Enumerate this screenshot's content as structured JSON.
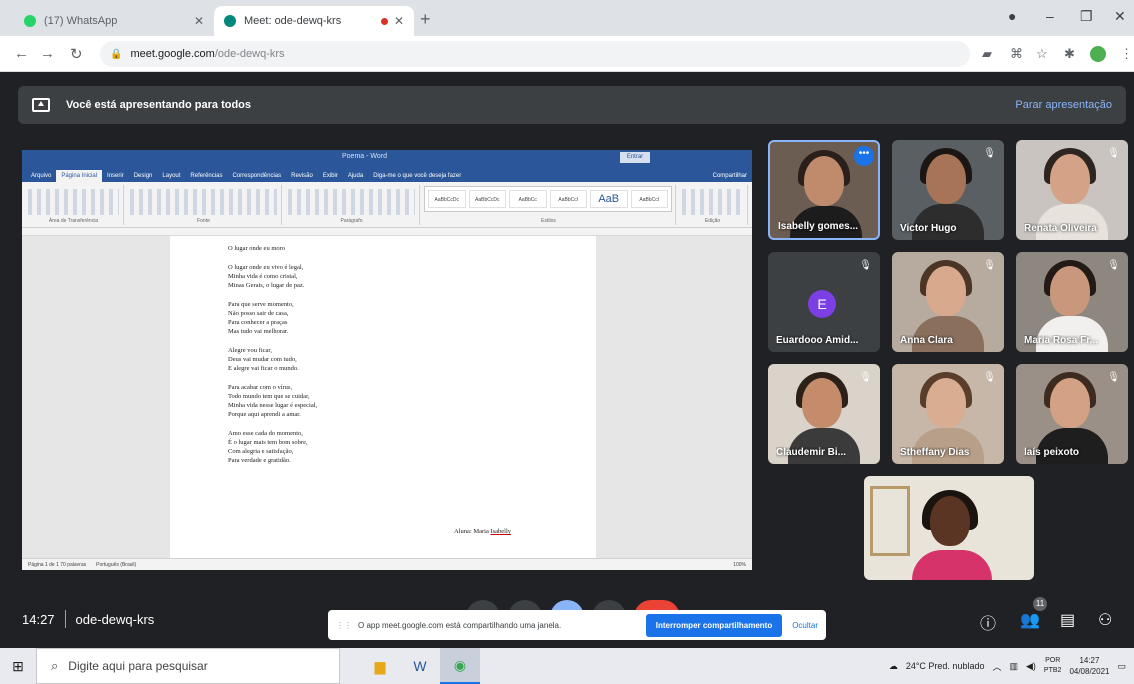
{
  "browser": {
    "tabs": [
      {
        "title": "(17) WhatsApp",
        "active": false,
        "favicon_color": "#25d366"
      },
      {
        "title": "Meet: ode-dewq-krs",
        "active": true,
        "favicon_color": "#00897b"
      }
    ],
    "url_host": "meet.google.com",
    "url_path": "/ode-dewq-krs"
  },
  "presenting": {
    "message": "Você está apresentando para todos",
    "stop_label": "Parar apresentação"
  },
  "word": {
    "title": "Poema - Word",
    "menus": [
      "Arquivo",
      "Página Inicial",
      "Inserir",
      "Design",
      "Layout",
      "Referências",
      "Correspondências",
      "Revisão",
      "Exibir",
      "Ajuda",
      "Diga-me o que você deseja fazer"
    ],
    "share_label": "Compartilhar",
    "signin_label": "Entrar",
    "ribbon_groups": [
      "Área de Transferência",
      "Fonte",
      "Parágrafo",
      "Estilos",
      "Edição"
    ],
    "styles": [
      "AaBbCcDc",
      "AaBbCcDc",
      "AaBbCc",
      "AaBbCcI",
      "AaB",
      "AaBbCcI"
    ],
    "poem_title": "O lugar onde eu moro",
    "stanzas": [
      [
        "O lugar onde eu vivo é legal,",
        "Minha vida é como cristal,",
        "Minas Gerais, o lugar de paz."
      ],
      [
        "Para que serve momento,",
        "Não posso sair de casa,",
        "Para conhecer a praças",
        "Mas tudo vai melhorar."
      ],
      [
        "Alegre vou ficar,",
        "Deus vai mudar com tudo,",
        "E alegre vai ficar o mundo."
      ],
      [
        "Para acabar com o vírus,",
        "Todo mundo tem que se cuidar,",
        "Minha vida nesse lugar é especial,",
        "Porque aqui aprendi a amar."
      ],
      [
        "Amo esse cada do momento,",
        "É o lugar mais tem bom sobre,",
        "Com alegria e satisfação,",
        "Para verdade e gratidão."
      ]
    ],
    "author_prefix": "Aluna: Maria",
    "author_name": "Isabelly",
    "status_left": "Página 1 de 1   70 palavras",
    "status_lang": "Português (Brasil)",
    "zoom": "100%"
  },
  "participants": [
    {
      "name": "Isabelly gomes...",
      "active": true,
      "avatar_letter": "",
      "hair": "#2a1f1a",
      "skin": "#c08a6c",
      "shirt": "#1c1c1c",
      "bg": "#6b5d52"
    },
    {
      "name": "Victor Hugo",
      "active": false,
      "avatar_letter": "",
      "hair": "#1b1614",
      "skin": "#a87458",
      "shirt": "#2d2d2d",
      "bg": "#5a5f63"
    },
    {
      "name": "Renata Oliveira",
      "active": false,
      "avatar_letter": "",
      "hair": "#2e2420",
      "skin": "#d4a387",
      "shirt": "#e7e2dc",
      "bg": "#c9c4bf"
    },
    {
      "name": "Euardooo Amid...",
      "active": false,
      "avatar_letter": "E",
      "hair": "",
      "skin": "",
      "shirt": "",
      "bg": "#3c4043"
    },
    {
      "name": "Anna Clara",
      "active": false,
      "avatar_letter": "",
      "hair": "#4a3526",
      "skin": "#d8a98c",
      "shirt": "#8a6f5d",
      "bg": "#b7aba0"
    },
    {
      "name": "Maria Rosa Fr...",
      "active": false,
      "avatar_letter": "",
      "hair": "#231a15",
      "skin": "#c9987c",
      "shirt": "#f2f0ee",
      "bg": "#8d8780"
    },
    {
      "name": "Claudemir Bi...",
      "active": false,
      "avatar_letter": "",
      "hair": "#2c2018",
      "skin": "#c48c6a",
      "shirt": "#3b3b3b",
      "bg": "#d9d3ca"
    },
    {
      "name": "Stheffany Dias",
      "active": false,
      "avatar_letter": "",
      "hair": "#5a3e2b",
      "skin": "#d9ad91",
      "shirt": "#b89f8a",
      "bg": "#c7b7a8"
    },
    {
      "name": "laís peixoto",
      "active": false,
      "avatar_letter": "",
      "hair": "#3e2b20",
      "skin": "#d3a184",
      "shirt": "#1e1e1e",
      "bg": "#9a9088"
    }
  ],
  "self_tile": {
    "bg": "#e9e4da",
    "skin": "#5a3524",
    "hair": "#1a1310",
    "shirt": "#d7336b"
  },
  "meeting": {
    "time": "14:27",
    "code": "ode-dewq-krs"
  },
  "share_notice": {
    "message": "O app meet.google.com está compartilhando uma janela.",
    "stop_label": "Interromper compartilhamento",
    "hide_label": "Ocultar"
  },
  "participant_count_badge": "11",
  "taskbar": {
    "search_placeholder": "Digite aqui para pesquisar",
    "weather": "24°C  Pred. nublado",
    "lang_top": "POR",
    "lang_bottom": "PTB2",
    "clock_time": "14:27",
    "clock_date": "04/08/2021"
  }
}
